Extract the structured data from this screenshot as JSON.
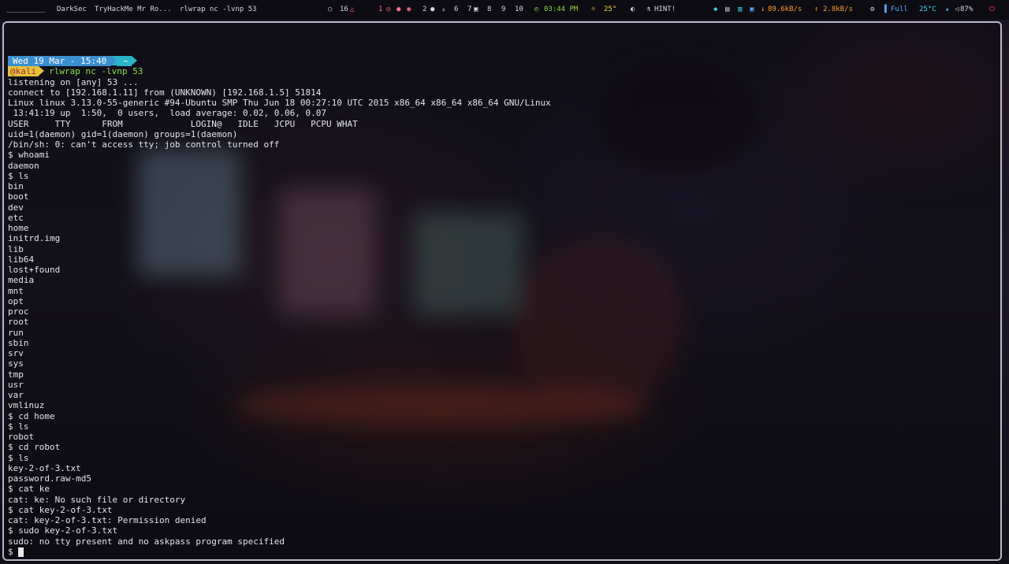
{
  "topbar": {
    "dash": "_________",
    "window_title_1": "DarkSec",
    "window_title_2": "TryHackMe Mr Ro...",
    "window_title_3": "rlwrap nc -lvnp 53",
    "notif_count": "16",
    "workspaces": [
      "1",
      "2",
      "6",
      "7",
      "8",
      "9",
      "10"
    ],
    "clock": "03:44 PM",
    "weather": "25°",
    "hint": "HINT!",
    "net_down": "89.6kB/s",
    "net_up": "2.8kB/s",
    "battery": "Full",
    "temp": "25°C",
    "volume": "87%"
  },
  "terminal": {
    "prompt": {
      "date": "Wed 19 Mar - 15:40",
      "dir": "~",
      "user": "@kali",
      "command": "rlwrap nc -lvnp 53"
    },
    "lines": [
      "listening on [any] 53 ...",
      "connect to [192.168.1.11] from (UNKNOWN) [192.168.1.5] 51814",
      "Linux linux 3.13.0-55-generic #94-Ubuntu SMP Thu Jun 18 00:27:10 UTC 2015 x86_64 x86_64 x86_64 GNU/Linux",
      " 13:41:19 up  1:50,  0 users,  load average: 0.02, 0.06, 0.07",
      "USER     TTY      FROM             LOGIN@   IDLE   JCPU   PCPU WHAT",
      "uid=1(daemon) gid=1(daemon) groups=1(daemon)",
      "/bin/sh: 0: can't access tty; job control turned off",
      "$ whoami",
      "daemon",
      "$ ls",
      "bin",
      "boot",
      "dev",
      "etc",
      "home",
      "initrd.img",
      "lib",
      "lib64",
      "lost+found",
      "media",
      "mnt",
      "opt",
      "proc",
      "root",
      "run",
      "sbin",
      "srv",
      "sys",
      "tmp",
      "usr",
      "var",
      "vmlinuz",
      "$ cd home",
      "$ ls",
      "robot",
      "$ cd robot",
      "$ ls",
      "key-2-of-3.txt",
      "password.raw-md5",
      "$ cat ke",
      "cat: ke: No such file or directory",
      "$ cat key-2-of-3.txt",
      "cat: key-2-of-3.txt: Permission denied",
      "$ sudo key-2-of-3.txt",
      "sudo: no tty present and no askpass program specified"
    ],
    "current_prompt": "$ "
  }
}
